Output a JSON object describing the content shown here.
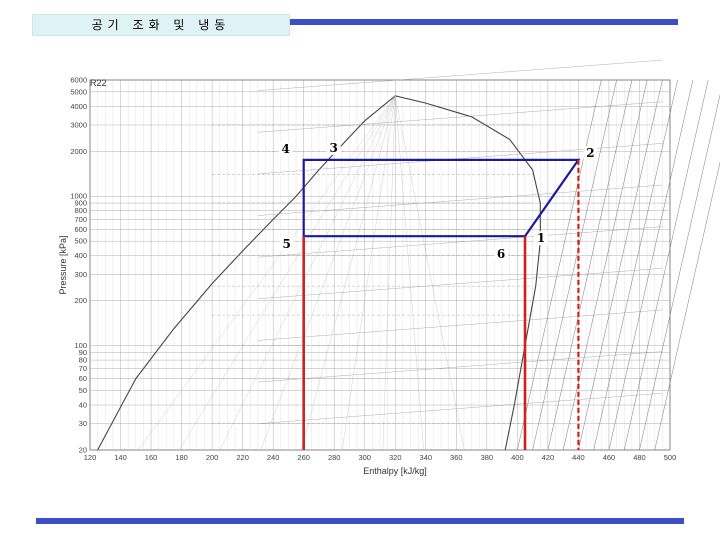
{
  "header": {
    "title": "공기 조화 및 냉동"
  },
  "chart": {
    "refrigerant": "R22",
    "xlabel": "Enthalpy [kJ/kg]",
    "ylabel": "Pressure [kPa]",
    "x_ticks": [
      "120",
      "140",
      "160",
      "180",
      "200",
      "220",
      "240",
      "260",
      "280",
      "300",
      "320",
      "340",
      "360",
      "380",
      "400",
      "420",
      "440",
      "460",
      "480",
      "500"
    ],
    "y_ticks": [
      "6000",
      "5000",
      "4000",
      "3000",
      "2000",
      "1000",
      "900",
      "800",
      "700",
      "600",
      "500",
      "400",
      "300",
      "200",
      "100",
      "90",
      "80",
      "70",
      "60",
      "50",
      "40",
      "30",
      "20"
    ],
    "state_points": [
      "1",
      "2",
      "3",
      "4",
      "5",
      "6"
    ],
    "line_colors": {
      "cycle": "#1a1a9e",
      "red": "#d0201a",
      "grid": "#9a9a9a"
    }
  },
  "chart_data": {
    "type": "line",
    "title": "R22",
    "xlabel": "Enthalpy [kJ/kg]",
    "ylabel": "Pressure [kPa]",
    "xlim": [
      120,
      500
    ],
    "ylim": [
      20,
      6000
    ],
    "yscale": "log",
    "series": [
      {
        "values_x": [
          405,
          440,
          260,
          260,
          405
        ],
        "values_y": [
          540,
          1750,
          1750,
          540,
          540
        ]
      },
      {
        "values_x": [
          260,
          260
        ],
        "values_y": [
          540,
          20
        ]
      },
      {
        "values_x": [
          405,
          405
        ],
        "values_y": [
          540,
          20
        ]
      },
      {
        "values_x": [
          440,
          440
        ],
        "values_y": [
          1750,
          20
        ]
      }
    ]
  }
}
